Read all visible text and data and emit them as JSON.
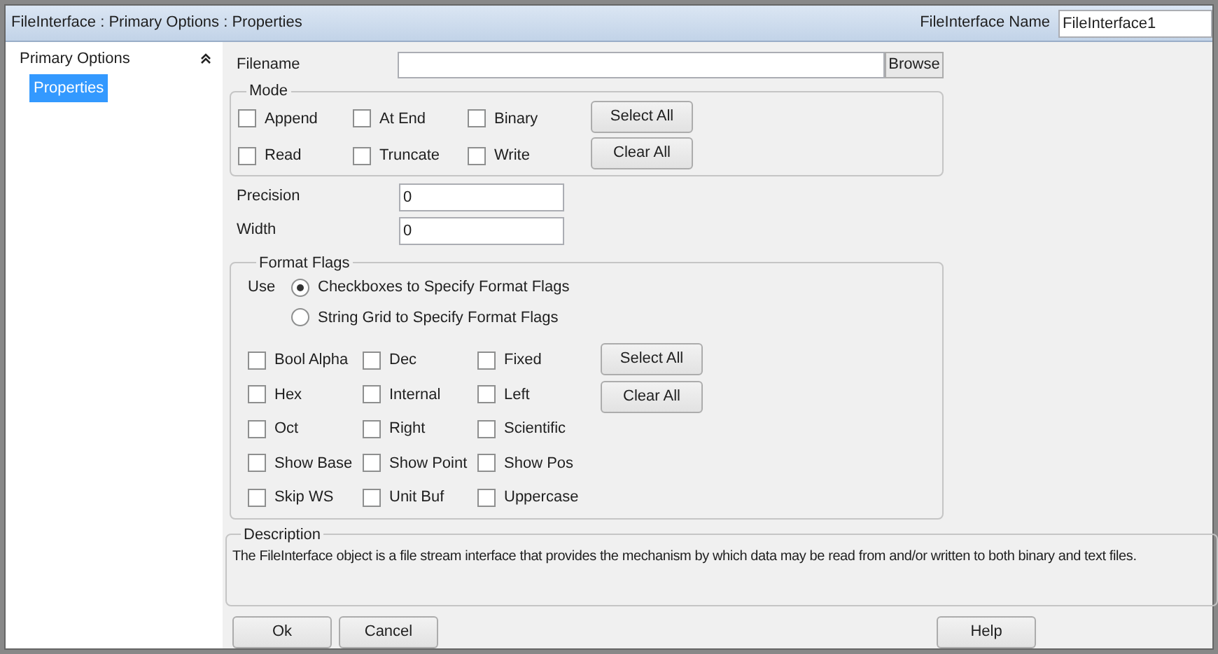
{
  "window": {
    "title": "FileInterface : Primary Options : Properties",
    "name_label": "FileInterface Name",
    "name_value": "FileInterface1"
  },
  "sidebar": {
    "items": [
      {
        "label": "Primary Options",
        "selected": false,
        "expanded": true,
        "children": [
          {
            "label": "Properties",
            "selected": true
          }
        ]
      }
    ]
  },
  "filename": {
    "label": "Filename",
    "button": "Browse"
  },
  "mode": {
    "title": "Mode",
    "options": [
      {
        "label": "Append",
        "checked": false
      },
      {
        "label": "At End",
        "checked": false
      },
      {
        "label": "Binary",
        "checked": false
      },
      {
        "label": "Read",
        "checked": false
      },
      {
        "label": "Truncate",
        "checked": false
      },
      {
        "label": "Write",
        "checked": false
      }
    ],
    "buttons": [
      "Select All",
      "Clear All"
    ]
  },
  "fields": [
    {
      "label": "Precision",
      "value": "0"
    },
    {
      "label": "Width",
      "value": "0"
    }
  ],
  "format_flags": {
    "title": "Format Flags",
    "use_label": "Use",
    "use_options": [
      {
        "label": "Checkboxes to Specify Format Flags",
        "selected": true
      },
      {
        "label": "String Grid to Specify Format Flags",
        "selected": false
      }
    ],
    "flags": [
      {
        "label": "Bool Alpha",
        "checked": false
      },
      {
        "label": "Dec",
        "checked": false
      },
      {
        "label": "Fixed",
        "checked": false
      },
      {
        "label": "Hex",
        "checked": false
      },
      {
        "label": "Internal",
        "checked": false
      },
      {
        "label": "Left",
        "checked": false
      },
      {
        "label": "Oct",
        "checked": false
      },
      {
        "label": "Right",
        "checked": false
      },
      {
        "label": "Scientific",
        "checked": false
      },
      {
        "label": "Show Base",
        "checked": false
      },
      {
        "label": "Show Point",
        "checked": false
      },
      {
        "label": "Show Pos",
        "checked": false
      },
      {
        "label": "Skip WS",
        "checked": false
      },
      {
        "label": "Unit Buf",
        "checked": false
      },
      {
        "label": "Uppercase",
        "checked": false
      }
    ],
    "buttons": [
      "Select All",
      "Clear All"
    ]
  },
  "description": {
    "title": "Description",
    "text": "The FileInterface object is a file stream interface that provides the mechanism by which data may be read from and/or written to both binary and text files."
  },
  "footer": {
    "buttons": [
      "Ok",
      "Cancel"
    ],
    "help": "Help"
  }
}
